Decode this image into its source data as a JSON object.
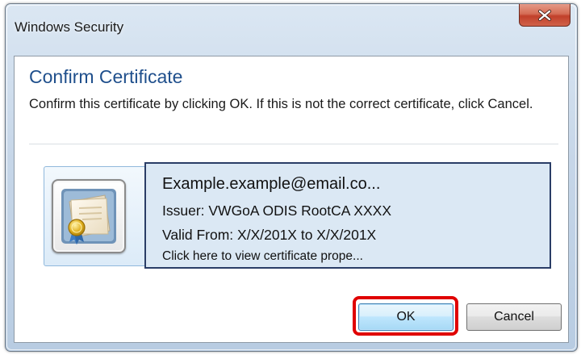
{
  "window": {
    "title": "Windows Security"
  },
  "dialog": {
    "heading": "Confirm Certificate",
    "message": "Confirm this certificate by clicking OK. If this is not the correct certificate, click Cancel."
  },
  "certificate": {
    "subject": "Example.example@email.co...",
    "issuer": "Issuer: VWGoA ODIS RootCA XXXX",
    "valid": "Valid From: X/X/201X to X/X/201X",
    "link": "Click here to view certificate prope..."
  },
  "buttons": {
    "ok": "OK",
    "cancel": "Cancel"
  },
  "colors": {
    "heading": "#1f4f8c",
    "highlight": "#e00000",
    "close_button": "#c1402a",
    "cert_panel": "#dbe8f4"
  },
  "icons": {
    "close": "close-icon",
    "certificate": "certificate-icon"
  }
}
